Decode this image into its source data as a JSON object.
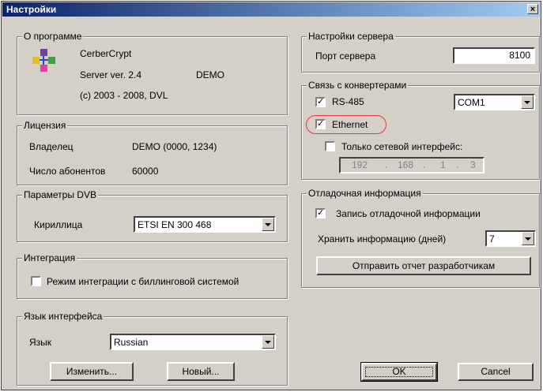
{
  "window": {
    "title": "Настройки",
    "close_label": "×"
  },
  "about": {
    "legend": "О программе",
    "app_name": "CerberCrypt",
    "version": "Server ver. 2.4",
    "edition": "DEMO",
    "copyright": "(c) 2003 - 2008, DVL",
    "icon": "app-logo-icon"
  },
  "license": {
    "legend": "Лицензия",
    "owner_label": "Владелец",
    "owner_value": "DEMO (0000, 1234)",
    "subscribers_label": "Число абонентов",
    "subscribers_value": "60000"
  },
  "dvb": {
    "legend": "Параметры DVB",
    "cyrillic_label": "Кириллица",
    "cyrillic_value": "ETSI EN 300 468"
  },
  "integration": {
    "legend": "Интеграция",
    "billing_label": "Режим интеграции с биллинговой системой",
    "billing_checked": false
  },
  "language": {
    "legend": "Язык интерфейса",
    "label": "Язык",
    "value": "Russian",
    "change_button": "Изменить...",
    "new_button": "Новый..."
  },
  "server": {
    "legend": "Настройки сервера",
    "port_label": "Порт сервера",
    "port_value": "8100"
  },
  "converters": {
    "legend": "Связь с конвертерами",
    "rs485_label": "RS-485",
    "rs485_checked": true,
    "com_value": "COM1",
    "ethernet_label": "Ethernet",
    "ethernet_checked": true,
    "net_only_label": "Только сетевой интерфейс:",
    "net_only_checked": false,
    "ip": [
      "192",
      "168",
      "1",
      "3"
    ],
    "ip_sep": "."
  },
  "debug": {
    "legend": "Отладочная информация",
    "write_label": "Запись отладочной информации",
    "write_checked": true,
    "keep_label": "Хранить информацию (дней)",
    "keep_value": "7",
    "send_button": "Отправить отчет разработчикам"
  },
  "footer": {
    "ok": "OK",
    "cancel": "Cancel"
  },
  "check_mark": "✓",
  "colors": {
    "title_start": "#0a246a",
    "title_end": "#a6caf0",
    "face": "#d4d0c8",
    "highlight": "#e83c3c"
  }
}
